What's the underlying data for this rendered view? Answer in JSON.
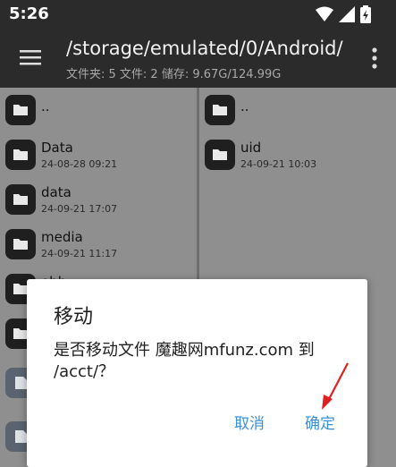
{
  "status_bar": {
    "time": "5:26",
    "icons": [
      "wifi-icon",
      "signal-icon",
      "battery-icon"
    ]
  },
  "toolbar": {
    "path": "/storage/emulated/0/Android/",
    "info": "文件夹: 5  文件: 2  储存: 9.67G/124.99G",
    "menu_icon": "menu-icon",
    "more_icon": "more-vert-icon"
  },
  "left_pane": [
    {
      "name": "..",
      "date": "",
      "type": "folder"
    },
    {
      "name": "Data",
      "date": "24-08-28 09:21",
      "type": "folder"
    },
    {
      "name": "data",
      "date": "24-09-21 17:07",
      "type": "folder"
    },
    {
      "name": "media",
      "date": "24-09-21 11:17",
      "type": "folder"
    },
    {
      "name": "obb",
      "date": "",
      "type": "folder"
    },
    {
      "name": "",
      "date": "",
      "type": "folder"
    },
    {
      "name": "",
      "date": "",
      "type": "file"
    },
    {
      "name": "",
      "date": "",
      "type": "file"
    }
  ],
  "right_pane": [
    {
      "name": "..",
      "date": "",
      "type": "folder"
    },
    {
      "name": "uid",
      "date": "24-09-21 10:03",
      "type": "folder"
    }
  ],
  "dialog": {
    "title": "移动",
    "message": "是否移动文件 魔趣网mfunz.com 到 /acct/？",
    "cancel": "取消",
    "confirm": "确定"
  },
  "colors": {
    "accent": "#3a8fd9",
    "annotation_arrow": "#e02020"
  }
}
